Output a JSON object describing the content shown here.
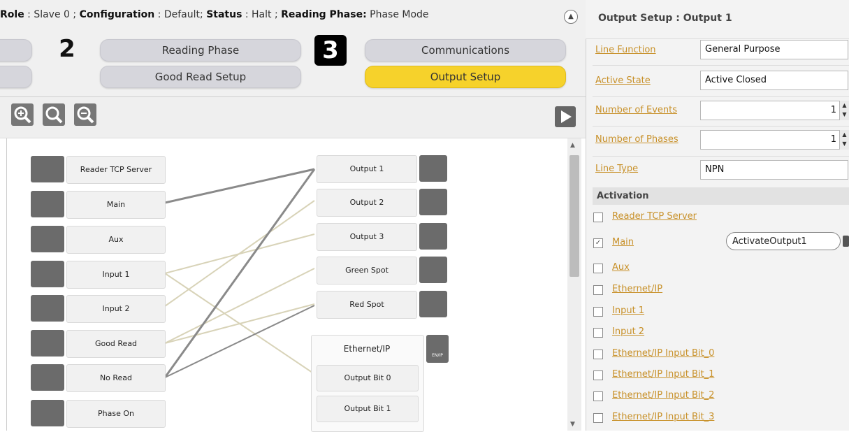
{
  "header": {
    "role_label": "Role",
    "role_value": "Slave 0",
    "config_label": "Configuration",
    "config_value": "Default",
    "status_label": "Status",
    "status_value": "Halt",
    "phase_label": "Reading Phase:",
    "phase_value": "Phase Mode"
  },
  "steps": {
    "step2_num": "2",
    "step3_num": "3",
    "reading_phase": "Reading Phase",
    "good_read_setup": "Good Read Setup",
    "communications": "Communications",
    "output_setup": "Output Setup"
  },
  "nodes": {
    "inputs": [
      "Reader TCP Server",
      "Main",
      "Aux",
      "Input 1",
      "Input 2",
      "Good Read",
      "No Read",
      "Phase On"
    ],
    "outputs": [
      "Output 1",
      "Output 2",
      "Output 3",
      "Green Spot",
      "Red Spot"
    ],
    "ethernet": {
      "title": "Ethernet/IP",
      "bits": [
        "Output Bit 0",
        "Output Bit 1"
      ],
      "icon_text": "EN/IP"
    }
  },
  "right_panel": {
    "title": "Output Setup :  Output 1",
    "fields": [
      {
        "label": "Line Function",
        "value": "General Purpose"
      },
      {
        "label": "Active State",
        "value": "Active Closed"
      },
      {
        "label": "Number of Events",
        "value": "1"
      },
      {
        "label": "Number of Phases",
        "value": "1"
      },
      {
        "label": "Line Type",
        "value": "NPN"
      }
    ],
    "activation_header": "Activation",
    "activation_items": [
      {
        "label": "Reader TCP Server",
        "checked": false
      },
      {
        "label": "Main",
        "checked": true,
        "value": "ActivateOutput1"
      },
      {
        "label": "Aux",
        "checked": false
      },
      {
        "label": "Ethernet/IP",
        "checked": false
      },
      {
        "label": "Input 1",
        "checked": false
      },
      {
        "label": "Input 2",
        "checked": false
      },
      {
        "label": "Ethernet/IP Input Bit_0",
        "checked": false
      },
      {
        "label": "Ethernet/IP Input Bit_1",
        "checked": false
      },
      {
        "label": "Ethernet/IP Input Bit_2",
        "checked": false
      },
      {
        "label": "Ethernet/IP Input Bit_3",
        "checked": false
      }
    ],
    "check_mark": "✓"
  },
  "colors": {
    "accent": "#f6d22b",
    "link": "#c8912a"
  }
}
